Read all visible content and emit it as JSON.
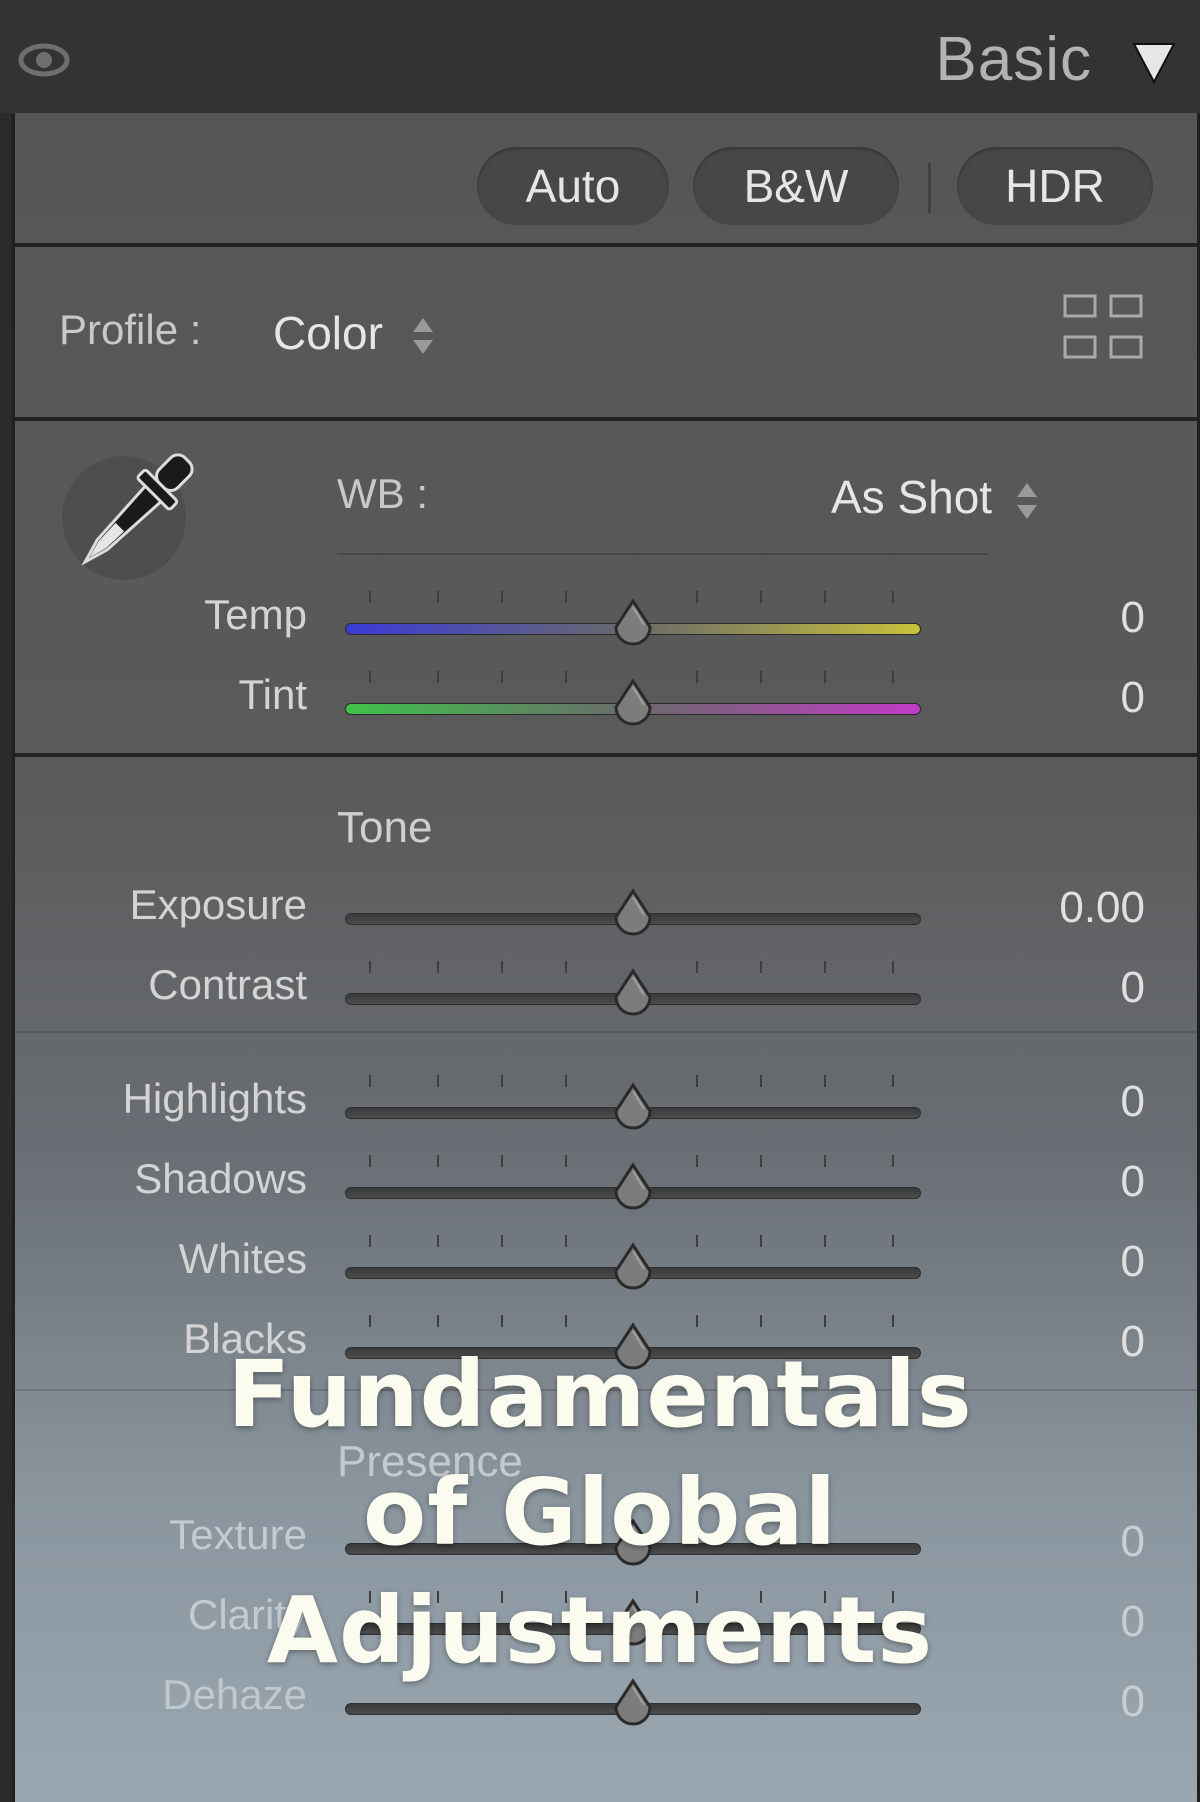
{
  "header": {
    "title": "Basic"
  },
  "buttons": {
    "auto": "Auto",
    "bw": "B&W",
    "hdr": "HDR"
  },
  "profile": {
    "label": "Profile :",
    "value": "Color"
  },
  "wb": {
    "label": "WB :",
    "value": "As Shot"
  },
  "sliders": {
    "temp": {
      "label": "Temp",
      "value": "0"
    },
    "tint": {
      "label": "Tint",
      "value": "0"
    },
    "exposure": {
      "label": "Exposure",
      "value": "0.00"
    },
    "contrast": {
      "label": "Contrast",
      "value": "0"
    },
    "highlights": {
      "label": "Highlights",
      "value": "0"
    },
    "shadows": {
      "label": "Shadows",
      "value": "0"
    },
    "whites": {
      "label": "Whites",
      "value": "0"
    },
    "blacks": {
      "label": "Blacks",
      "value": "0"
    },
    "texture": {
      "label": "Texture",
      "value": "0"
    },
    "clarity": {
      "label": "Clarity",
      "value": "0"
    },
    "dehaze": {
      "label": "Dehaze",
      "value": "0"
    }
  },
  "sections": {
    "tone": "Tone",
    "presence": "Presence"
  },
  "overlay": {
    "line1": "Fundamentals",
    "line2": "of Global",
    "line3": "Adjustments"
  },
  "colors": {
    "temp_gradient": [
      "#3b3bd8",
      "#c8c23a"
    ],
    "tint_gradient": [
      "#3fc24a",
      "#c23ac8"
    ],
    "overlay_text": "#fbfbf0"
  },
  "icons": {
    "eye": "eye-icon",
    "collapse": "triangle-down-icon",
    "grid": "grid-icon",
    "eyedropper": "eyedropper-icon",
    "stepper": "updown-stepper-icon"
  }
}
